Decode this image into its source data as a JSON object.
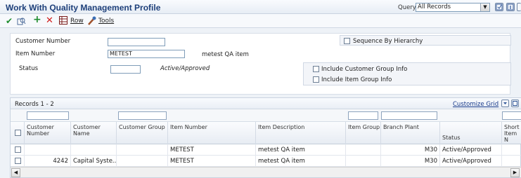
{
  "header": {
    "title": "Work With Quality Management Profile",
    "query_label": "Query:",
    "query_value": "All Records"
  },
  "toolbar": {
    "row_label": "Row",
    "tools_label": "Tools"
  },
  "form": {
    "customer_number_label": "Customer Number",
    "customer_number_value": "",
    "item_number_label": "Item Number",
    "item_number_value": "METEST",
    "item_description": "metest QA item",
    "status_label": "Status",
    "status_value": "",
    "status_description": "Active/Approved",
    "sequence_by_hierarchy_label": "Sequence By Hierarchy",
    "include_customer_group_label": "Include Customer Group Info",
    "include_item_group_label": "Include Item Group Info"
  },
  "grid": {
    "records_label": "Records 1 - 2",
    "customize_label": "Customize Grid",
    "columns": [
      "Customer Number",
      "Customer Name",
      "Customer Group",
      "Item Number",
      "Item Description",
      "Item Group",
      "Branch Plant",
      "Status",
      "Short Item N"
    ],
    "rows": [
      {
        "customer_number": "",
        "customer_name": "",
        "customer_group": "",
        "item_number": "METEST",
        "item_description": "metest QA item",
        "item_group": "",
        "branch_plant": "M30",
        "status": "Active/Approved"
      },
      {
        "customer_number": "4242",
        "customer_name": "Capital Syste...",
        "customer_group": "",
        "item_number": "METEST",
        "item_description": "metest QA item",
        "item_group": "",
        "branch_plant": "M30",
        "status": "Active/Approved"
      }
    ]
  },
  "colors": {
    "title": "#1d3f7a",
    "link": "#1a3c8c",
    "select_check": "#1e8c2e",
    "add_plus": "#1e8c2e",
    "delete_x": "#d01c1c"
  },
  "icons": [
    "select-check-icon",
    "copy-icon",
    "add-icon",
    "delete-icon",
    "row-grid-icon",
    "tools-icon",
    "personalize-icon",
    "help-icon",
    "export-icon",
    "maximize-icon"
  ]
}
